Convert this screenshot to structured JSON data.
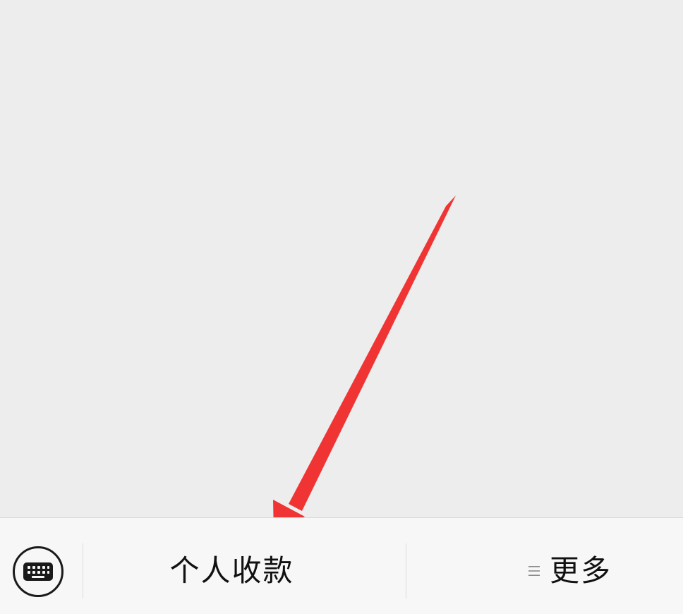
{
  "colors": {
    "chat_background": "#ededed",
    "bottom_bar_background": "#f7f7f7",
    "annotation_arrow": "#f03434",
    "text": "#111111"
  },
  "bottom_bar": {
    "keyboard_toggle_icon": "keyboard-icon",
    "menu_personal_collect_label": "个人收款",
    "menu_more_icon": "menu-lines-icon",
    "menu_more_label": "更多"
  }
}
